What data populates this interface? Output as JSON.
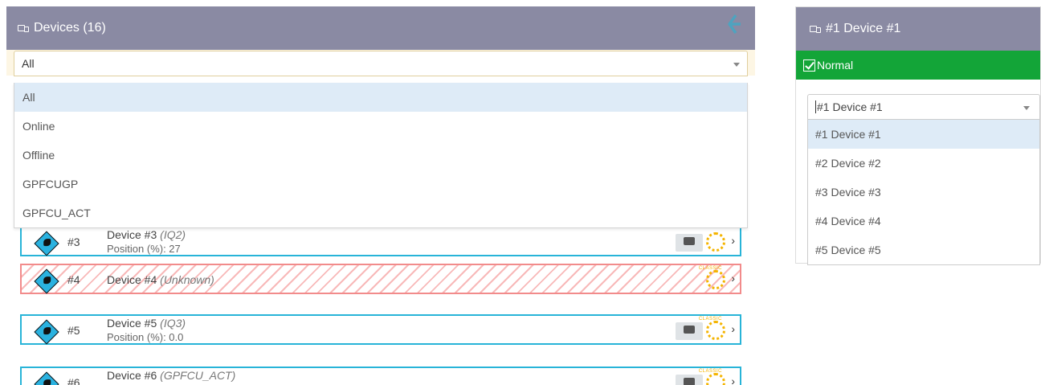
{
  "left_panel": {
    "title": "Devices (16)",
    "filter": {
      "selected": "All",
      "options": [
        "All",
        "Online",
        "Offline",
        "GPFCUGP",
        "GPFCU_ACT"
      ]
    },
    "devices": [
      {
        "num": "#3",
        "name": "Device #3",
        "type": "(IQ2)",
        "position": "Position (%): 27",
        "status": "normal"
      },
      {
        "num": "#4",
        "name": "Device #4",
        "type": "(Unknown)",
        "position": "",
        "status": "unknown"
      },
      {
        "num": "#5",
        "name": "Device #5",
        "type": "(IQ3)",
        "position": "Position (%): 0.0",
        "status": "normal"
      },
      {
        "num": "#6",
        "name": "Device #6",
        "type": "(GPFCU_ACT)",
        "position": "",
        "status": "normal"
      }
    ],
    "classic_label": "CLASSIC"
  },
  "right_panel": {
    "title": "#1 Device #1",
    "status_label": "Normal",
    "status_color": "#13a538",
    "device_select": {
      "selected": "#1 Device #1",
      "options": [
        "#1 Device #1",
        "#2 Device #2",
        "#3 Device #3",
        "#4 Device #4",
        "#5 Device #5"
      ]
    }
  },
  "colors": {
    "header_bg": "#8a8aa3",
    "row_border": "#28b4d8",
    "unknown_border": "#f28b8b",
    "dropdown_highlight": "#deebf7"
  },
  "icons": [
    "devices-icon",
    "back-arrow-icon",
    "diamond-device-icon",
    "checkbox-icon",
    "caret-down-icon",
    "chevron-right-icon"
  ]
}
